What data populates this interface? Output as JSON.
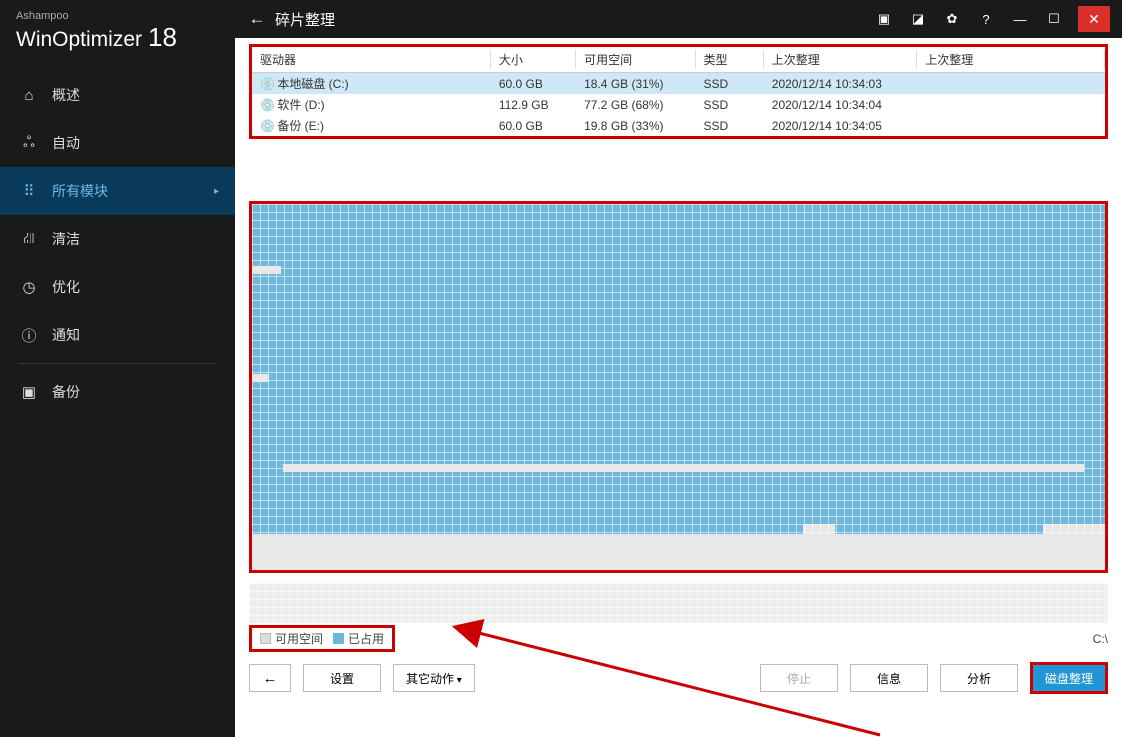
{
  "logo": {
    "sub": "Ashampoo",
    "main": "WinOptimizer",
    "num": "18"
  },
  "nav": {
    "overview": "概述",
    "auto": "自动",
    "all_modules": "所有模块",
    "clean": "清洁",
    "optimize": "优化",
    "notify": "通知",
    "backup": "备份"
  },
  "titlebar": {
    "title": "碎片整理"
  },
  "columns": {
    "drive": "驱动器",
    "size": "大小",
    "free": "可用空间",
    "type": "类型",
    "last_defrag": "上次整理",
    "prev_defrag": "上次整理"
  },
  "drives": [
    {
      "name": "本地磁盘 (C:)",
      "size": "60.0 GB",
      "free": "18.4 GB (31%)",
      "type": "SSD",
      "last": "2020/12/14 10:34:03",
      "selected": true
    },
    {
      "name": "软件 (D:)",
      "size": "112.9 GB",
      "free": "77.2 GB (68%)",
      "type": "SSD",
      "last": "2020/12/14 10:34:04",
      "selected": false
    },
    {
      "name": "备份 (E:)",
      "size": "60.0 GB",
      "free": "19.8 GB (33%)",
      "type": "SSD",
      "last": "2020/12/14 10:34:05",
      "selected": false
    }
  ],
  "legend": {
    "free": "可用空间",
    "used": "已占用",
    "drive_label": "C:\\"
  },
  "buttons": {
    "settings": "设置",
    "other_actions": "其它动作",
    "stop": "停止",
    "info": "信息",
    "analyze": "分析",
    "defrag": "磁盘整理"
  }
}
